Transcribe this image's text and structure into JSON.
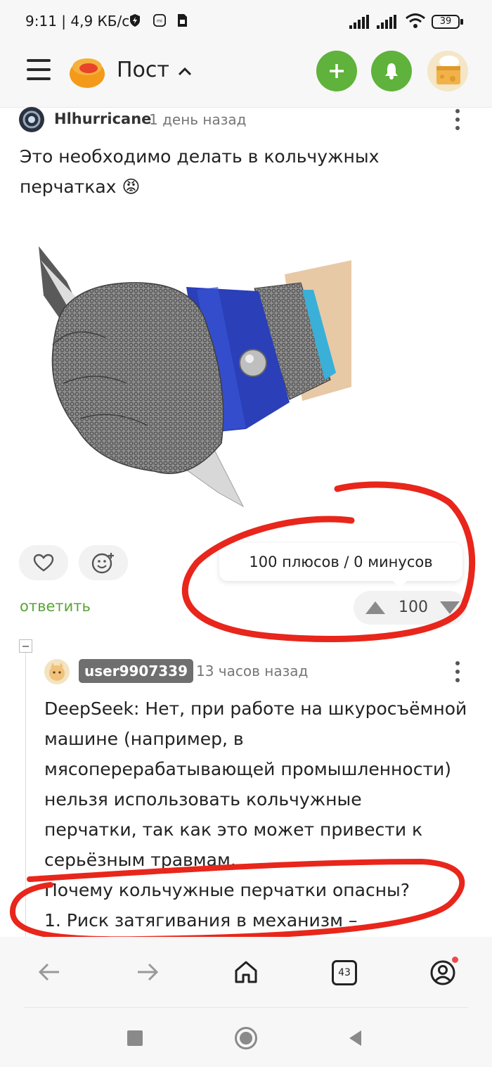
{
  "status_bar": {
    "time": "9:11 | 4,9 КБ/с",
    "battery": "39"
  },
  "header": {
    "title": "Пост"
  },
  "comment": {
    "author": "Hlhurricane",
    "time_ago": "1 день назад",
    "text_line1": "Это необходимо делать в кольчужных",
    "text_line2": "перчатках 😡",
    "votes_tooltip": "100 плюсов / 0 минусов",
    "rating": "100",
    "reply_label": "ответить"
  },
  "reply_comment": {
    "author": "user9907339",
    "time_ago": "13 часов назад",
    "lines": [
      "DeepSeek: Нет, при работе на шкуросъёмной",
      "машине (например, в",
      "мясоперерабатывающей промышленности)",
      "нельзя использовать кольчужные",
      "перчатки, так как это может привести к",
      "серьёзным травмам.",
      "Почему кольчужные перчатки опасны?",
      "1. Риск затягивания в механизм –"
    ]
  },
  "bottom_nav": {
    "tabs_count": "43"
  },
  "colors": {
    "accent_green": "#5fb23b",
    "annotation_red": "#e8261b"
  }
}
